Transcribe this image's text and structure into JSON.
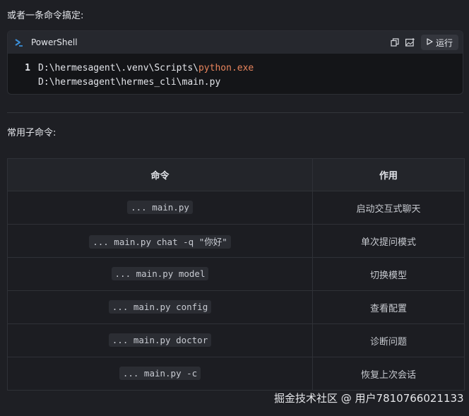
{
  "intro_text": "或者一条命令搞定:",
  "code_block": {
    "language": "PowerShell",
    "run_label": "运行",
    "lines": [
      {
        "number": "1",
        "prefix": "D:\\hermesagent\\.venv\\Scripts\\",
        "highlight": "python.exe"
      },
      {
        "number": "",
        "prefix": "D:\\hermesagent\\hermes_cli\\main.py",
        "highlight": ""
      }
    ]
  },
  "subtitle": "常用子命令:",
  "table": {
    "headers": [
      "命令",
      "作用"
    ],
    "rows": [
      {
        "command": "... main.py",
        "description": "启动交互式聊天"
      },
      {
        "command": "... main.py chat -q \"你好\"",
        "description": "单次提问模式"
      },
      {
        "command": "... main.py model",
        "description": "切换模型"
      },
      {
        "command": "... main.py config",
        "description": "查看配置"
      },
      {
        "command": "... main.py doctor",
        "description": "诊断问题"
      },
      {
        "command": "... main.py -c",
        "description": "恢复上次会话"
      }
    ]
  },
  "watermark": "掘金技术社区 @ 用户7810766021133",
  "colors": {
    "background": "#1e1f24",
    "code_background": "#141518",
    "highlight": "#e8845c",
    "powershell_icon": "#3b8fd8"
  },
  "icons": {
    "language": "powershell-icon",
    "copy": "copy-icon",
    "image": "image-icon",
    "run": "play-icon"
  }
}
